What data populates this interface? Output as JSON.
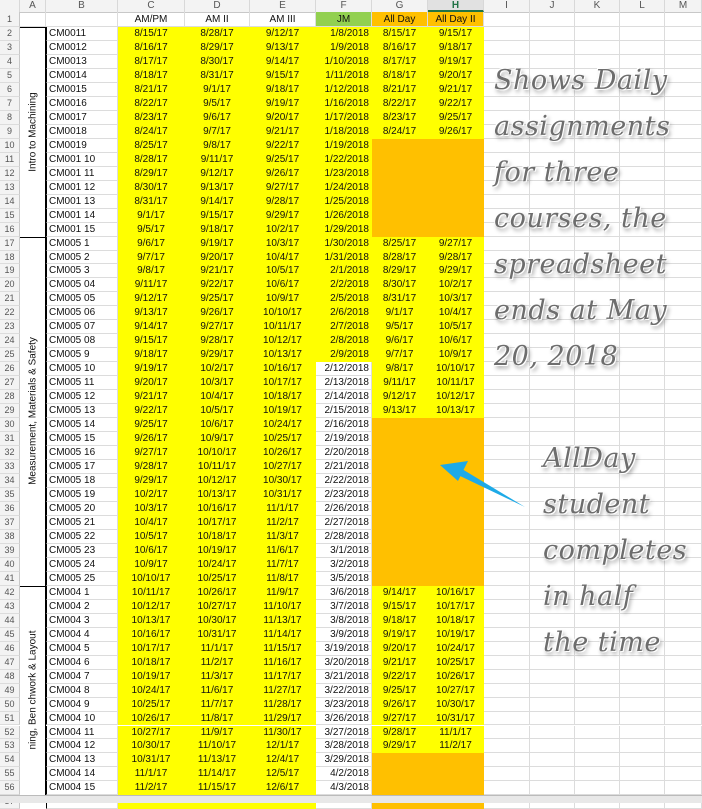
{
  "columns": [
    "A",
    "B",
    "C",
    "D",
    "E",
    "F",
    "G",
    "H",
    "I",
    "J",
    "K",
    "L",
    "M"
  ],
  "selected_column": "H",
  "headers": {
    "C": "AM/PM",
    "D": "AM II",
    "E": "AM III",
    "F": "JM",
    "G": "All Day",
    "H": "All Day II"
  },
  "header_colors": {
    "F": "#92d050",
    "G": "#ffc000",
    "H": "#ffc000"
  },
  "groups": [
    {
      "label": "Intro to Machining",
      "first_row": 2,
      "last_row": 16
    },
    {
      "label": "Measurement, Materials & Safety",
      "first_row": 17,
      "last_row": 41
    },
    {
      "label": "ning, Ben chwork & Layout",
      "first_row": 42,
      "last_row": 57
    }
  ],
  "rows": [
    {
      "row": 2,
      "id": "CM0011",
      "C": "8/15/17",
      "D": "8/28/17",
      "E": "9/12/17",
      "F": "1/8/2018",
      "G": "8/15/17",
      "H": "9/15/17"
    },
    {
      "row": 3,
      "id": "CM0012",
      "C": "8/16/17",
      "D": "8/29/17",
      "E": "9/13/17",
      "F": "1/9/2018",
      "G": "8/16/17",
      "H": "9/18/17"
    },
    {
      "row": 4,
      "id": "CM0013",
      "C": "8/17/17",
      "D": "8/30/17",
      "E": "9/14/17",
      "F": "1/10/2018",
      "G": "8/17/17",
      "H": "9/19/17"
    },
    {
      "row": 5,
      "id": "CM0014",
      "C": "8/18/17",
      "D": "8/31/17",
      "E": "9/15/17",
      "F": "1/11/2018",
      "G": "8/18/17",
      "H": "9/20/17"
    },
    {
      "row": 6,
      "id": "CM0015",
      "C": "8/21/17",
      "D": "9/1/17",
      "E": "9/18/17",
      "F": "1/12/2018",
      "G": "8/21/17",
      "H": "9/21/17"
    },
    {
      "row": 7,
      "id": "CM0016",
      "C": "8/22/17",
      "D": "9/5/17",
      "E": "9/19/17",
      "F": "1/16/2018",
      "G": "8/22/17",
      "H": "9/22/17"
    },
    {
      "row": 8,
      "id": "CM0017",
      "C": "8/23/17",
      "D": "9/6/17",
      "E": "9/20/17",
      "F": "1/17/2018",
      "G": "8/23/17",
      "H": "9/25/17"
    },
    {
      "row": 9,
      "id": "CM0018",
      "C": "8/24/17",
      "D": "9/7/17",
      "E": "9/21/17",
      "F": "1/18/2018",
      "G": "8/24/17",
      "H": "9/26/17"
    },
    {
      "row": 10,
      "id": "CM0019",
      "C": "8/25/17",
      "D": "9/8/17",
      "E": "9/22/17",
      "F": "1/19/2018",
      "G": "",
      "H": ""
    },
    {
      "row": 11,
      "id": "CM001 10",
      "C": "8/28/17",
      "D": "9/11/17",
      "E": "9/25/17",
      "F": "1/22/2018",
      "G": "",
      "H": ""
    },
    {
      "row": 12,
      "id": "CM001 11",
      "C": "8/29/17",
      "D": "9/12/17",
      "E": "9/26/17",
      "F": "1/23/2018",
      "G": "",
      "H": ""
    },
    {
      "row": 13,
      "id": "CM001 12",
      "C": "8/30/17",
      "D": "9/13/17",
      "E": "9/27/17",
      "F": "1/24/2018",
      "G": "",
      "H": ""
    },
    {
      "row": 14,
      "id": "CM001 13",
      "C": "8/31/17",
      "D": "9/14/17",
      "E": "9/28/17",
      "F": "1/25/2018",
      "G": "",
      "H": ""
    },
    {
      "row": 15,
      "id": "CM001 14",
      "C": "9/1/17",
      "D": "9/15/17",
      "E": "9/29/17",
      "F": "1/26/2018",
      "G": "",
      "H": ""
    },
    {
      "row": 16,
      "id": "CM001 15",
      "C": "9/5/17",
      "D": "9/18/17",
      "E": "10/2/17",
      "F": "1/29/2018",
      "G": "",
      "H": ""
    },
    {
      "row": 17,
      "id": "CM005 1",
      "C": "9/6/17",
      "D": "9/19/17",
      "E": "10/3/17",
      "F": "1/30/2018",
      "G": "8/25/17",
      "H": "9/27/17"
    },
    {
      "row": 18,
      "id": "CM005 2",
      "C": "9/7/17",
      "D": "9/20/17",
      "E": "10/4/17",
      "F": "1/31/2018",
      "G": "8/28/17",
      "H": "9/28/17"
    },
    {
      "row": 19,
      "id": "CM005 3",
      "C": "9/8/17",
      "D": "9/21/17",
      "E": "10/5/17",
      "F": "2/1/2018",
      "G": "8/29/17",
      "H": "9/29/17"
    },
    {
      "row": 20,
      "id": "CM005 04",
      "C": "9/11/17",
      "D": "9/22/17",
      "E": "10/6/17",
      "F": "2/2/2018",
      "G": "8/30/17",
      "H": "10/2/17"
    },
    {
      "row": 21,
      "id": "CM005 05",
      "C": "9/12/17",
      "D": "9/25/17",
      "E": "10/9/17",
      "F": "2/5/2018",
      "G": "8/31/17",
      "H": "10/3/17"
    },
    {
      "row": 22,
      "id": "CM005 06",
      "C": "9/13/17",
      "D": "9/26/17",
      "E": "10/10/17",
      "F": "2/6/2018",
      "G": "9/1/17",
      "H": "10/4/17"
    },
    {
      "row": 23,
      "id": "CM005 07",
      "C": "9/14/17",
      "D": "9/27/17",
      "E": "10/11/17",
      "F": "2/7/2018",
      "G": "9/5/17",
      "H": "10/5/17"
    },
    {
      "row": 24,
      "id": "CM005 08",
      "C": "9/15/17",
      "D": "9/28/17",
      "E": "10/12/17",
      "F": "2/8/2018",
      "G": "9/6/17",
      "H": "10/6/17"
    },
    {
      "row": 25,
      "id": "CM005 9",
      "C": "9/18/17",
      "D": "9/29/17",
      "E": "10/13/17",
      "F": "2/9/2018",
      "G": "9/7/17",
      "H": "10/9/17"
    },
    {
      "row": 26,
      "id": "CM005 10",
      "C": "9/19/17",
      "D": "10/2/17",
      "E": "10/16/17",
      "F": "2/12/2018",
      "G": "9/8/17",
      "H": "10/10/17"
    },
    {
      "row": 27,
      "id": "CM005 11",
      "C": "9/20/17",
      "D": "10/3/17",
      "E": "10/17/17",
      "F": "2/13/2018",
      "G": "9/11/17",
      "H": "10/11/17"
    },
    {
      "row": 28,
      "id": "CM005 12",
      "C": "9/21/17",
      "D": "10/4/17",
      "E": "10/18/17",
      "F": "2/14/2018",
      "G": "9/12/17",
      "H": "10/12/17"
    },
    {
      "row": 29,
      "id": "CM005 13",
      "C": "9/22/17",
      "D": "10/5/17",
      "E": "10/19/17",
      "F": "2/15/2018",
      "G": "9/13/17",
      "H": "10/13/17"
    },
    {
      "row": 30,
      "id": "CM005 14",
      "C": "9/25/17",
      "D": "10/6/17",
      "E": "10/24/17",
      "F": "2/16/2018",
      "G": "",
      "H": ""
    },
    {
      "row": 31,
      "id": "CM005 15",
      "C": "9/26/17",
      "D": "10/9/17",
      "E": "10/25/17",
      "F": "2/19/2018",
      "G": "",
      "H": ""
    },
    {
      "row": 32,
      "id": "CM005 16",
      "C": "9/27/17",
      "D": "10/10/17",
      "E": "10/26/17",
      "F": "2/20/2018",
      "G": "",
      "H": ""
    },
    {
      "row": 33,
      "id": "CM005 17",
      "C": "9/28/17",
      "D": "10/11/17",
      "E": "10/27/17",
      "F": "2/21/2018",
      "G": "",
      "H": ""
    },
    {
      "row": 34,
      "id": "CM005 18",
      "C": "9/29/17",
      "D": "10/12/17",
      "E": "10/30/17",
      "F": "2/22/2018",
      "G": "",
      "H": ""
    },
    {
      "row": 35,
      "id": "CM005 19",
      "C": "10/2/17",
      "D": "10/13/17",
      "E": "10/31/17",
      "F": "2/23/2018",
      "G": "",
      "H": ""
    },
    {
      "row": 36,
      "id": "CM005 20",
      "C": "10/3/17",
      "D": "10/16/17",
      "E": "11/1/17",
      "F": "2/26/2018",
      "G": "",
      "H": ""
    },
    {
      "row": 37,
      "id": "CM005 21",
      "C": "10/4/17",
      "D": "10/17/17",
      "E": "11/2/17",
      "F": "2/27/2018",
      "G": "",
      "H": ""
    },
    {
      "row": 38,
      "id": "CM005 22",
      "C": "10/5/17",
      "D": "10/18/17",
      "E": "11/3/17",
      "F": "2/28/2018",
      "G": "",
      "H": ""
    },
    {
      "row": 39,
      "id": "CM005 23",
      "C": "10/6/17",
      "D": "10/19/17",
      "E": "11/6/17",
      "F": "3/1/2018",
      "G": "",
      "H": ""
    },
    {
      "row": 40,
      "id": "CM005 24",
      "C": "10/9/17",
      "D": "10/24/17",
      "E": "11/7/17",
      "F": "3/2/2018",
      "G": "",
      "H": ""
    },
    {
      "row": 41,
      "id": "CM005 25",
      "C": "10/10/17",
      "D": "10/25/17",
      "E": "11/8/17",
      "F": "3/5/2018",
      "G": "",
      "H": ""
    },
    {
      "row": 42,
      "id": "CM004 1",
      "C": "10/11/17",
      "D": "10/26/17",
      "E": "11/9/17",
      "F": "3/6/2018",
      "G": "9/14/17",
      "H": "10/16/17"
    },
    {
      "row": 43,
      "id": "CM004 2",
      "C": "10/12/17",
      "D": "10/27/17",
      "E": "11/10/17",
      "F": "3/7/2018",
      "G": "9/15/17",
      "H": "10/17/17"
    },
    {
      "row": 44,
      "id": "CM004 3",
      "C": "10/13/17",
      "D": "10/30/17",
      "E": "11/13/17",
      "F": "3/8/2018",
      "G": "9/18/17",
      "H": "10/18/17"
    },
    {
      "row": 45,
      "id": "CM004 4",
      "C": "10/16/17",
      "D": "10/31/17",
      "E": "11/14/17",
      "F": "3/9/2018",
      "G": "9/19/17",
      "H": "10/19/17"
    },
    {
      "row": 46,
      "id": "CM004 5",
      "C": "10/17/17",
      "D": "11/1/17",
      "E": "11/15/17",
      "F": "3/19/2018",
      "G": "9/20/17",
      "H": "10/24/17"
    },
    {
      "row": 47,
      "id": "CM004 6",
      "C": "10/18/17",
      "D": "11/2/17",
      "E": "11/16/17",
      "F": "3/20/2018",
      "G": "9/21/17",
      "H": "10/25/17"
    },
    {
      "row": 48,
      "id": "CM004 7",
      "C": "10/19/17",
      "D": "11/3/17",
      "E": "11/17/17",
      "F": "3/21/2018",
      "G": "9/22/17",
      "H": "10/26/17"
    },
    {
      "row": 49,
      "id": "CM004 8",
      "C": "10/24/17",
      "D": "11/6/17",
      "E": "11/27/17",
      "F": "3/22/2018",
      "G": "9/25/17",
      "H": "10/27/17"
    },
    {
      "row": 50,
      "id": "CM004 9",
      "C": "10/25/17",
      "D": "11/7/17",
      "E": "11/28/17",
      "F": "3/23/2018",
      "G": "9/26/17",
      "H": "10/30/17"
    },
    {
      "row": 51,
      "id": "CM004 10",
      "C": "10/26/17",
      "D": "11/8/17",
      "E": "11/29/17",
      "F": "3/26/2018",
      "G": "9/27/17",
      "H": "10/31/17"
    },
    {
      "row": 52,
      "id": "CM004 11",
      "C": "10/27/17",
      "D": "11/9/17",
      "E": "11/30/17",
      "F": "3/27/2018",
      "G": "9/28/17",
      "H": "11/1/17"
    },
    {
      "row": 53,
      "id": "CM004 12",
      "C": "10/30/17",
      "D": "11/10/17",
      "E": "12/1/17",
      "F": "3/28/2018",
      "G": "9/29/17",
      "H": "11/2/17"
    },
    {
      "row": 54,
      "id": "CM004 13",
      "C": "10/31/17",
      "D": "11/13/17",
      "E": "12/4/17",
      "F": "3/29/2018",
      "G": "",
      "H": ""
    },
    {
      "row": 55,
      "id": "CM004 14",
      "C": "11/1/17",
      "D": "11/14/17",
      "E": "12/5/17",
      "F": "4/2/2018",
      "G": "",
      "H": ""
    },
    {
      "row": 56,
      "id": "CM004 15",
      "C": "11/2/17",
      "D": "11/15/17",
      "E": "12/6/17",
      "F": "4/3/2018",
      "G": "",
      "H": ""
    }
  ],
  "f_white_rows": [
    26,
    27,
    28,
    29,
    30,
    31,
    32,
    33,
    34,
    35,
    36,
    37,
    38,
    39,
    40,
    41,
    42,
    43,
    44,
    45,
    46,
    47,
    48,
    49,
    50,
    51,
    52,
    53,
    54,
    55,
    56,
    57
  ],
  "fill_colors": {
    "yellow": "#ffff00",
    "orange": "#ffc000",
    "green": "#92d050"
  },
  "annotations": {
    "top_note": [
      "Shows Daily",
      "assignments",
      "for three",
      "courses, the",
      "spreadsheet",
      "ends at May",
      "20, 2018"
    ],
    "bottom_note": [
      "AllDay",
      "student",
      "completes",
      "in half",
      "the time"
    ],
    "arrow_color": "#1eaae7"
  }
}
